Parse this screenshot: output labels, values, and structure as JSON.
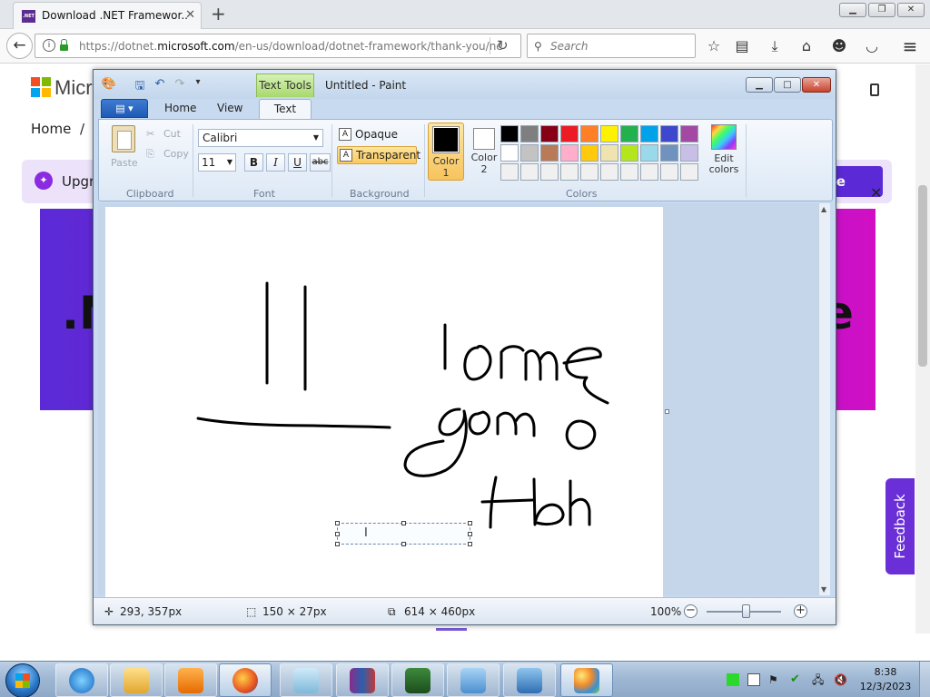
{
  "browser": {
    "tab_title": "Download .NET Framewor...",
    "tab_favicon_text": ".NET",
    "url_prefix": "https://dotnet.",
    "url_domain": "microsoft.com",
    "url_path": "/en-us/download/dotnet-framework/thank-you/ne",
    "search_placeholder": "Search",
    "icons": [
      "back-icon",
      "info-icon",
      "lock-icon",
      "reload-icon",
      "search-icon",
      "bookmark-star-icon",
      "reading-list-icon",
      "download-arrow-icon",
      "home-icon",
      "emoji-icon",
      "pocket-icon",
      "menu-icon"
    ]
  },
  "webpage": {
    "logo_text": "Micr",
    "breadcrumb_home": "Home",
    "breadcrumb_sep": "/",
    "banner_text": "Upgr",
    "banner_more": "ore",
    "hero_left_text": ".N",
    "hero_right_text": "e",
    "feedback_label": "Feedback",
    "colors": {
      "hero_start": "#5b2ad6",
      "hero_end": "#d10fc5",
      "banner_bg": "#ece3fb",
      "feedback_bg": "#6b2fd8"
    }
  },
  "paint": {
    "context_tab": "Text Tools",
    "title": "Untitled - Paint",
    "tabs": [
      "Home",
      "View",
      "Text"
    ],
    "active_tab": "Text",
    "clipboard": {
      "paste": "Paste",
      "cut": "Cut",
      "copy": "Copy",
      "group": "Clipboard"
    },
    "font": {
      "family": "Calibri",
      "size": "11",
      "bold": "B",
      "italic": "I",
      "underline": "U",
      "strike": "abc",
      "group": "Font"
    },
    "background": {
      "opaque": "Opaque",
      "transparent": "Transparent",
      "selected": "Transparent",
      "group": "Background"
    },
    "colors": {
      "color1_label": "Color 1",
      "color1_line1": "Color",
      "color1_line2": "1",
      "color1_value": "#000000",
      "color2_line1": "Color",
      "color2_line2": "2",
      "color2_value": "#ffffff",
      "edit_line1": "Edit",
      "edit_line2": "colors",
      "group": "Colors",
      "row1": [
        "#000000",
        "#7f7f7f",
        "#880015",
        "#ed1c24",
        "#ff7f27",
        "#fff200",
        "#22b14c",
        "#00a2e8",
        "#3f48cc",
        "#a349a4"
      ],
      "row2": [
        "#ffffff",
        "#c3c3c3",
        "#b97a57",
        "#ffaec9",
        "#ffc90e",
        "#efe4b0",
        "#b5e61d",
        "#99d9ea",
        "#7092be",
        "#c8bfe7"
      ],
      "row3": [
        "#f0f0f0",
        "#f0f0f0",
        "#f0f0f0",
        "#f0f0f0",
        "#f0f0f0",
        "#f0f0f0",
        "#f0f0f0",
        "#f0f0f0",
        "#f0f0f0",
        "#f0f0f0"
      ]
    },
    "drawing_text": [
      "11",
      "lome",
      "gomo",
      "tbh"
    ],
    "status": {
      "cursor": "293, 357px",
      "selection": "150 × 27px",
      "image_size": "614 × 460px",
      "zoom": "100%"
    }
  },
  "taskbar": {
    "clock_time": "8:38",
    "clock_date": "12/3/2023",
    "apps": [
      "internet-explorer",
      "file-explorer",
      "media-player",
      "firefox",
      "notepad",
      "winrar",
      "task-manager",
      "control-panel",
      "remote-desktop",
      "paint"
    ],
    "active_app": "firefox"
  }
}
